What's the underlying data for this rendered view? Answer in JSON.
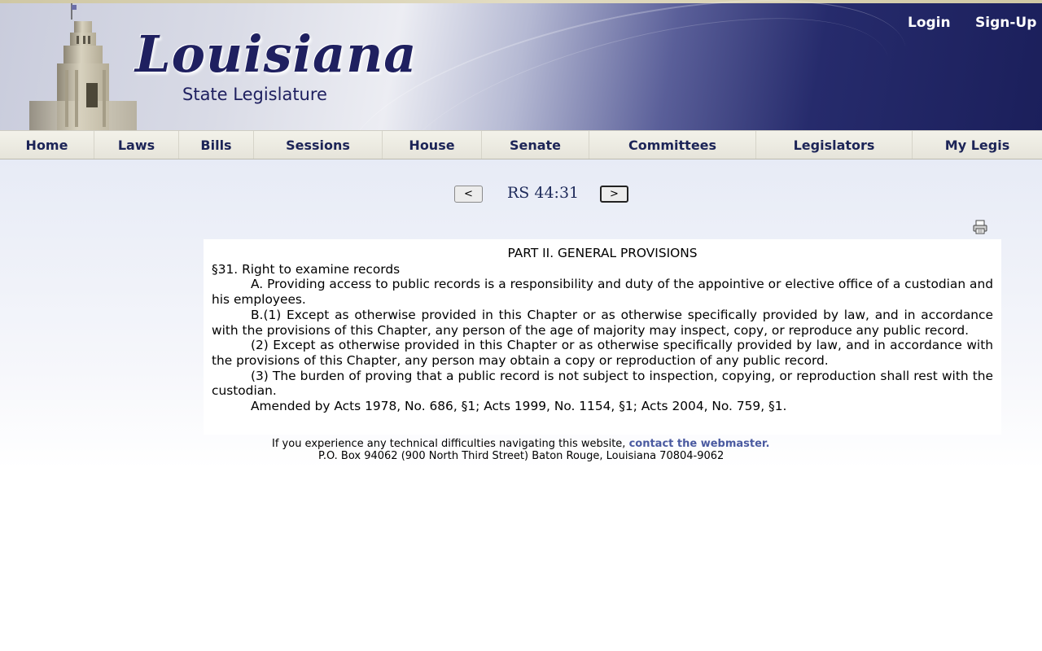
{
  "header": {
    "logo_title": "Louisiana",
    "logo_subtitle": "State Legislature",
    "login_label": "Login",
    "signup_label": "Sign-Up"
  },
  "nav": {
    "items": [
      {
        "label": "Home"
      },
      {
        "label": "Laws"
      },
      {
        "label": "Bills"
      },
      {
        "label": "Sessions"
      },
      {
        "label": "House"
      },
      {
        "label": "Senate"
      },
      {
        "label": "Committees"
      },
      {
        "label": "Legislators"
      },
      {
        "label": "My Legis"
      }
    ]
  },
  "pager": {
    "prev_label": "<",
    "next_label": ">",
    "statute_id": "RS 44:31"
  },
  "document": {
    "part_heading": "PART II.  GENERAL PROVISIONS",
    "section_title": "§31.  Right to examine records",
    "paragraphs": [
      "A.  Providing access to public records is a responsibility and duty of the appointive or elective office of a custodian and his employees.",
      "B.(1)  Except as otherwise provided in this Chapter or as otherwise specifically provided by law, and in accordance with the provisions of this Chapter, any person of the age of majority may inspect, copy, or reproduce any public record.",
      "(2)  Except as otherwise provided in this Chapter or as otherwise specifically provided by law, and in accordance with the provisions of this Chapter, any person may obtain a copy or reproduction of any public record.",
      "(3)  The burden of proving that a public record is not subject to inspection, copying, or reproduction shall rest with the custodian.",
      "Amended by Acts 1978, No. 686, §1; Acts 1999, No. 1154, §1; Acts 2004, No. 759, §1."
    ]
  },
  "footer": {
    "help_text": "If you experience any technical difficulties navigating this website, ",
    "webmaster_link": "contact the webmaster.",
    "address": "P.O. Box 94062 (900 North Third Street) Baton Rouge, Louisiana 70804-9062"
  },
  "colors": {
    "brand_navy": "#1f2060",
    "nav_text": "#1c2457",
    "link": "#4a5aa0"
  },
  "icons": {
    "print": "printer-icon",
    "logo": "capitol-building-icon"
  }
}
